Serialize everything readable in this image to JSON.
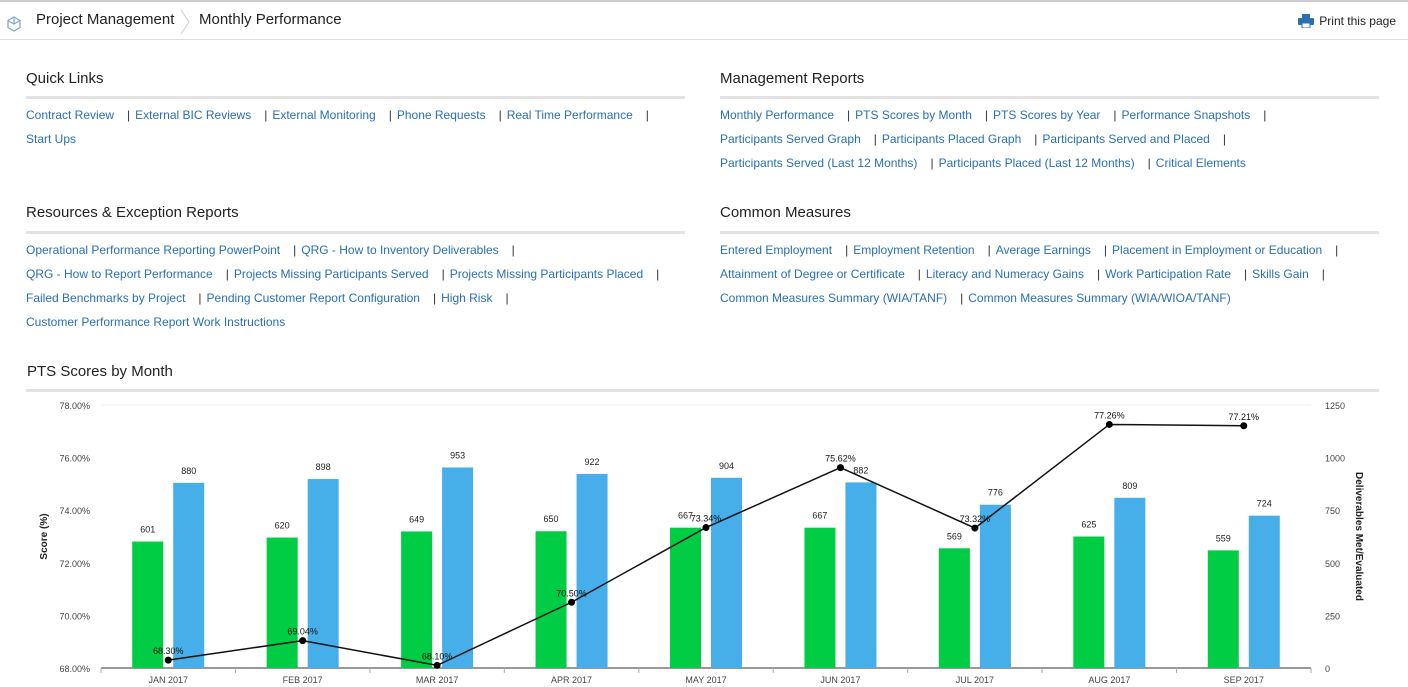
{
  "header": {
    "crumb1": "Project Management",
    "crumb2": "Monthly Performance",
    "print_label": "Print this page"
  },
  "quick_links": {
    "title": "Quick Links",
    "rows": [
      [
        "Contract Review",
        "External BIC Reviews",
        "External Monitoring",
        "Phone Requests",
        "Real Time Performance"
      ],
      [
        "Start Ups"
      ]
    ]
  },
  "management_reports": {
    "title": "Management Reports",
    "rows": [
      [
        "Monthly Performance",
        "PTS Scores by Month",
        "PTS Scores by Year",
        "Performance Snapshots"
      ],
      [
        "Participants Served Graph",
        "Participants Placed Graph",
        "Participants Served and Placed"
      ],
      [
        "Participants Served (Last 12 Months)",
        "Participants Placed (Last 12 Months)",
        "Critical Elements"
      ]
    ]
  },
  "resources_reports": {
    "title": "Resources & Exception Reports",
    "rows": [
      [
        "Operational Performance Reporting PowerPoint",
        "QRG - How to Inventory Deliverables"
      ],
      [
        "QRG - How to Report Performance",
        "Projects Missing Participants Served",
        "Projects Missing Participants Placed"
      ],
      [
        "Failed Benchmarks by Project",
        "Pending Customer Report Configuration",
        "High Risk"
      ],
      [
        "Customer Performance Report Work Instructions"
      ]
    ]
  },
  "common_measures": {
    "title": "Common Measures",
    "rows": [
      [
        "Entered Employment",
        "Employment Retention",
        "Average Earnings",
        "Placement in Employment or Education"
      ],
      [
        "Attainment of Degree or Certificate",
        "Literacy and Numeracy Gains",
        "Work Participation Rate",
        "Skills Gain"
      ],
      [
        "Common Measures Summary (WIA/TANF)",
        "Common Measures Summary (WIA/WIOA/TANF)"
      ]
    ]
  },
  "chart_section_title": "PTS Scores by Month",
  "chart_data": {
    "type": "bar",
    "categories": [
      "JAN 2017",
      "FEB 2017",
      "MAR 2017",
      "APR 2017",
      "MAY 2017",
      "JUN 2017",
      "JUL 2017",
      "AUG 2017",
      "SEP 2017"
    ],
    "series": [
      {
        "name": "",
        "type": "bar",
        "axis": "right",
        "color": "#00cc44",
        "values": [
          601,
          620,
          649,
          650,
          667,
          667,
          569,
          625,
          559
        ]
      },
      {
        "name": "",
        "type": "bar",
        "axis": "right",
        "color": "#46aee8",
        "values": [
          880,
          898,
          953,
          922,
          904,
          882,
          776,
          809,
          724
        ]
      },
      {
        "name": "",
        "type": "line",
        "axis": "left",
        "color": "#111111",
        "values": [
          68.3,
          69.04,
          68.1,
          70.5,
          73.34,
          75.62,
          73.32,
          77.26,
          77.21
        ]
      }
    ],
    "line_labels": [
      "68.30%",
      "69.04%",
      "68.10%",
      "70.50%",
      "73.34%",
      "75.62%",
      "73.32%",
      "77.26%",
      "77.21%"
    ],
    "left_axis": {
      "label": "Score (%)",
      "ticks": [
        "78.00%",
        "76.00%",
        "74.00%",
        "72.00%",
        "70.00%",
        "68.00%"
      ],
      "min": 68,
      "max": 78
    },
    "right_axis": {
      "label": "Deliverables Met/Evaluated",
      "ticks": [
        "1250",
        "1000",
        "750",
        "500",
        "250",
        "0"
      ],
      "min": 0,
      "max": 1250
    },
    "grid": false,
    "legend": "none"
  }
}
